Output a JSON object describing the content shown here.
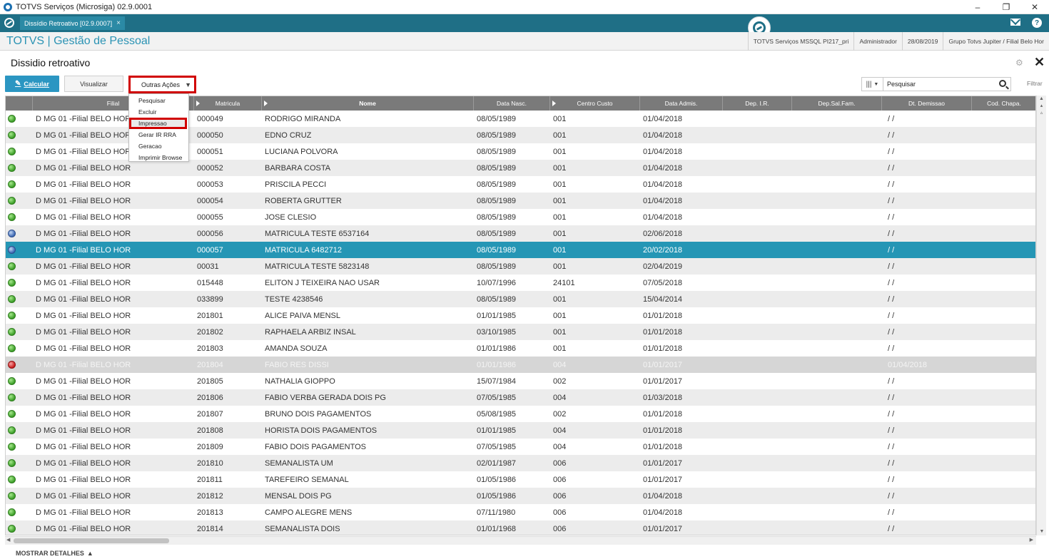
{
  "window": {
    "title": "TOTVS Serviços (Microsiga) 02.9.0001",
    "minimize": "–",
    "restore": "❐",
    "close": "✕"
  },
  "tabbar": {
    "tab_label": "Dissídio Retroativo [02.9.0007]",
    "tab_close": "×",
    "help": "?"
  },
  "header": {
    "app_title": "TOTVS | Gestão de Pessoal",
    "info": [
      "TOTVS Serviços MSSQL PI217_pri",
      "Administrador",
      "28/08/2019",
      "Grupo Totvs Jupiter / Filial Belo Hor"
    ]
  },
  "page": {
    "title": "Dissidio retroativo",
    "gear": "⚙",
    "close": "✕"
  },
  "toolbar": {
    "calc_label": "Calcular",
    "vis_label": "Visualizar",
    "outras_label": "Outras Ações",
    "caret": "▼",
    "menu": [
      "Pesquisar",
      "Excluir",
      "Impressao",
      "Gerar IR RRA",
      "Geracao",
      "Imprimir Browse"
    ],
    "search_placeholder": "Pesquisar",
    "filter_label": "Filtrar"
  },
  "grid": {
    "columns": [
      "",
      "Filial",
      "Matricula",
      "Nome",
      "Data Nasc.",
      "Centro Custo",
      "Data Admis.",
      "Dep. I.R.",
      "Dep.Sal.Fam.",
      "Dt. Demissao",
      "Cod. Chapa."
    ],
    "rows": [
      {
        "status": "green",
        "filial": "D MG 01 -Filial BELO HOR",
        "matricula": "000049",
        "nome": "RODRIGO MIRANDA",
        "nasc": "08/05/1989",
        "cc": "001",
        "admis": "01/04/2018",
        "demissao": "/ /"
      },
      {
        "status": "green",
        "filial": "D MG 01 -Filial BELO HOR",
        "matricula": "000050",
        "nome": "EDNO CRUZ",
        "nasc": "08/05/1989",
        "cc": "001",
        "admis": "01/04/2018",
        "demissao": "/ /"
      },
      {
        "status": "green",
        "filial": "D MG 01 -Filial BELO HOR",
        "matricula": "000051",
        "nome": "LUCIANA POLVORA",
        "nasc": "08/05/1989",
        "cc": "001",
        "admis": "01/04/2018",
        "demissao": "/ /"
      },
      {
        "status": "green",
        "filial": "D MG 01 -Filial BELO HOR",
        "matricula": "000052",
        "nome": "BARBARA COSTA",
        "nasc": "08/05/1989",
        "cc": "001",
        "admis": "01/04/2018",
        "demissao": "/ /"
      },
      {
        "status": "green",
        "filial": "D MG 01 -Filial BELO HOR",
        "matricula": "000053",
        "nome": "PRISCILA PECCI",
        "nasc": "08/05/1989",
        "cc": "001",
        "admis": "01/04/2018",
        "demissao": "/ /"
      },
      {
        "status": "green",
        "filial": "D MG 01 -Filial BELO HOR",
        "matricula": "000054",
        "nome": "ROBERTA GRUTTER",
        "nasc": "08/05/1989",
        "cc": "001",
        "admis": "01/04/2018",
        "demissao": "/ /"
      },
      {
        "status": "green",
        "filial": "D MG 01 -Filial BELO HOR",
        "matricula": "000055",
        "nome": "JOSE CLESIO",
        "nasc": "08/05/1989",
        "cc": "001",
        "admis": "01/04/2018",
        "demissao": "/ /"
      },
      {
        "status": "blue",
        "filial": "D MG 01 -Filial BELO HOR",
        "matricula": "000056",
        "nome": "MATRICULA TESTE 6537164",
        "nasc": "08/05/1989",
        "cc": "001",
        "admis": "02/06/2018",
        "demissao": "/ /"
      },
      {
        "status": "blue",
        "filial": "D MG 01 -Filial BELO HOR",
        "matricula": "000057",
        "nome": "MATRICULA 6482712",
        "nasc": "08/05/1989",
        "cc": "001",
        "admis": "20/02/2018",
        "demissao": "/ /",
        "selected": true
      },
      {
        "status": "green",
        "filial": "D MG 01 -Filial BELO HOR",
        "matricula": "00031",
        "nome": "MATRICULA TESTE 5823148",
        "nasc": "08/05/1989",
        "cc": "001",
        "admis": "02/04/2019",
        "demissao": "/ /"
      },
      {
        "status": "green",
        "filial": "D MG 01 -Filial BELO HOR",
        "matricula": "015448",
        "nome": "ELITON J TEIXEIRA NAO USAR",
        "nasc": "10/07/1996",
        "cc": "24101",
        "admis": "07/05/2018",
        "demissao": "/ /"
      },
      {
        "status": "green",
        "filial": "D MG 01 -Filial BELO HOR",
        "matricula": "033899",
        "nome": "TESTE 4238546",
        "nasc": "08/05/1989",
        "cc": "001",
        "admis": "15/04/2014",
        "demissao": "/ /"
      },
      {
        "status": "green",
        "filial": "D MG 01 -Filial BELO HOR",
        "matricula": "201801",
        "nome": "ALICE PAIVA MENSL",
        "nasc": "01/01/1985",
        "cc": "001",
        "admis": "01/01/2018",
        "demissao": "/ /"
      },
      {
        "status": "green",
        "filial": "D MG 01 -Filial BELO HOR",
        "matricula": "201802",
        "nome": "RAPHAELA ARBIZ INSAL",
        "nasc": "03/10/1985",
        "cc": "001",
        "admis": "01/01/2018",
        "demissao": "/ /"
      },
      {
        "status": "green",
        "filial": "D MG 01 -Filial BELO HOR",
        "matricula": "201803",
        "nome": "AMANDA SOUZA",
        "nasc": "01/01/1986",
        "cc": "001",
        "admis": "01/01/2018",
        "demissao": "/ /"
      },
      {
        "status": "red",
        "filial": "D MG 01 -Filial BELO HOR",
        "matricula": "201804",
        "nome": "FABIO RES DISSI",
        "nasc": "01/01/1986",
        "cc": "004",
        "admis": "01/01/2017",
        "demissao": "01/04/2018",
        "dimmed": true
      },
      {
        "status": "green",
        "filial": "D MG 01 -Filial BELO HOR",
        "matricula": "201805",
        "nome": "NATHALIA GIOPPO",
        "nasc": "15/07/1984",
        "cc": "002",
        "admis": "01/01/2017",
        "demissao": "/ /"
      },
      {
        "status": "green",
        "filial": "D MG 01 -Filial BELO HOR",
        "matricula": "201806",
        "nome": "FABIO VERBA GERADA DOIS PG",
        "nasc": "07/05/1985",
        "cc": "004",
        "admis": "01/03/2018",
        "demissao": "/ /"
      },
      {
        "status": "green",
        "filial": "D MG 01 -Filial BELO HOR",
        "matricula": "201807",
        "nome": "BRUNO DOIS PAGAMENTOS",
        "nasc": "05/08/1985",
        "cc": "002",
        "admis": "01/01/2018",
        "demissao": "/ /"
      },
      {
        "status": "green",
        "filial": "D MG 01 -Filial BELO HOR",
        "matricula": "201808",
        "nome": "HORISTA DOIS PAGAMENTOS",
        "nasc": "01/01/1985",
        "cc": "004",
        "admis": "01/01/2018",
        "demissao": "/ /"
      },
      {
        "status": "green",
        "filial": "D MG 01 -Filial BELO HOR",
        "matricula": "201809",
        "nome": "FABIO DOIS PAGAMENTOS",
        "nasc": "07/05/1985",
        "cc": "004",
        "admis": "01/01/2018",
        "demissao": "/ /"
      },
      {
        "status": "green",
        "filial": "D MG 01 -Filial BELO HOR",
        "matricula": "201810",
        "nome": "SEMANALISTA UM",
        "nasc": "02/01/1987",
        "cc": "006",
        "admis": "01/01/2017",
        "demissao": "/ /"
      },
      {
        "status": "green",
        "filial": "D MG 01 -Filial BELO HOR",
        "matricula": "201811",
        "nome": "TAREFEIRO SEMANAL",
        "nasc": "01/05/1986",
        "cc": "006",
        "admis": "01/01/2017",
        "demissao": "/ /"
      },
      {
        "status": "green",
        "filial": "D MG 01 -Filial BELO HOR",
        "matricula": "201812",
        "nome": "MENSAL DOIS PG",
        "nasc": "01/05/1986",
        "cc": "006",
        "admis": "01/04/2018",
        "demissao": "/ /"
      },
      {
        "status": "green",
        "filial": "D MG 01 -Filial BELO HOR",
        "matricula": "201813",
        "nome": "CAMPO ALEGRE MENS",
        "nasc": "07/11/1980",
        "cc": "006",
        "admis": "01/04/2018",
        "demissao": "/ /"
      },
      {
        "status": "green",
        "filial": "D MG 01 -Filial BELO HOR",
        "matricula": "201814",
        "nome": "SEMANALISTA DOIS",
        "nasc": "01/01/1968",
        "cc": "006",
        "admis": "01/01/2017",
        "demissao": "/ /"
      }
    ]
  },
  "footer": {
    "details_label": "MOSTRAR DETALHES",
    "details_caret": "▲"
  },
  "colors": {
    "tabbar": "#1f6f86",
    "accent": "#2b96c2",
    "selected_row": "#2596b5",
    "highlight_border": "#d10000",
    "header_grid": "#7a7a7a"
  }
}
